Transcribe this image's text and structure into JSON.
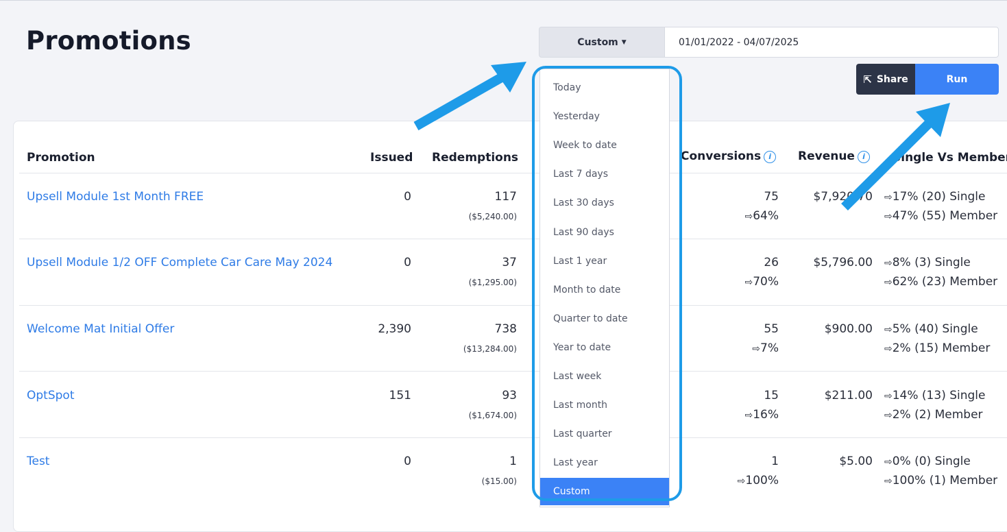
{
  "page_title": "Promotions",
  "date_range": {
    "selected": "Custom",
    "value": "01/01/2022 - 04/07/2025"
  },
  "actions": {
    "share_label": "Share",
    "run_label": "Run"
  },
  "table": {
    "headers": {
      "promotion": "Promotion",
      "issued": "Issued",
      "redemptions": "Redemptions",
      "conversions": "Conversions",
      "revenue": "Revenue",
      "single_vs_member": "Single Vs Member"
    },
    "rows": [
      {
        "name": "Upsell Module 1st Month FREE",
        "issued": "0",
        "redemptions": "117",
        "redemptions_amount": "($5,240.00)",
        "conversions": "75",
        "conversion_rate": "64%",
        "revenue": "$7,920.70",
        "single": "17% (20) Single",
        "member": "47% (55) Member"
      },
      {
        "name": "Upsell Module 1/2 OFF Complete Car Care May 2024",
        "issued": "0",
        "redemptions": "37",
        "redemptions_amount": "($1,295.00)",
        "conversions": "26",
        "conversion_rate": "70%",
        "revenue": "$5,796.00",
        "single": "8% (3) Single",
        "member": "62% (23) Member"
      },
      {
        "name": "Welcome Mat Initial Offer",
        "issued": "2,390",
        "redemptions": "738",
        "redemptions_amount": "($13,284.00)",
        "conversions": "55",
        "conversion_rate": "7%",
        "revenue": "$900.00",
        "single": "5% (40) Single",
        "member": "2% (15) Member"
      },
      {
        "name": "OptSpot",
        "issued": "151",
        "redemptions": "93",
        "redemptions_amount": "($1,674.00)",
        "conversions": "15",
        "conversion_rate": "16%",
        "revenue": "$211.00",
        "single": "14% (13) Single",
        "member": "2% (2) Member"
      },
      {
        "name": "Test",
        "issued": "0",
        "redemptions": "1",
        "redemptions_amount": "($15.00)",
        "conversions": "1",
        "conversion_rate": "100%",
        "revenue": "$5.00",
        "single": "0% (0) Single",
        "member": "100% (1) Member"
      }
    ]
  },
  "dropdown": {
    "items": [
      "Today",
      "Yesterday",
      "Week to date",
      "Last 7 days",
      "Last 30 days",
      "Last 90 days",
      "Last 1 year",
      "Month to date",
      "Quarter to date",
      "Year to date",
      "Last week",
      "Last month",
      "Last quarter",
      "Last year",
      "Custom"
    ],
    "active": "Custom"
  },
  "colors": {
    "accent": "#3b82f6",
    "link": "#2e7be6",
    "annotation": "#1e9be8",
    "share_bg": "#2c3447"
  },
  "icons": {
    "share": "share-icon",
    "caret": "caret-down-icon",
    "info": "info-icon",
    "conversion_arrow": "arrow-right-icon"
  }
}
